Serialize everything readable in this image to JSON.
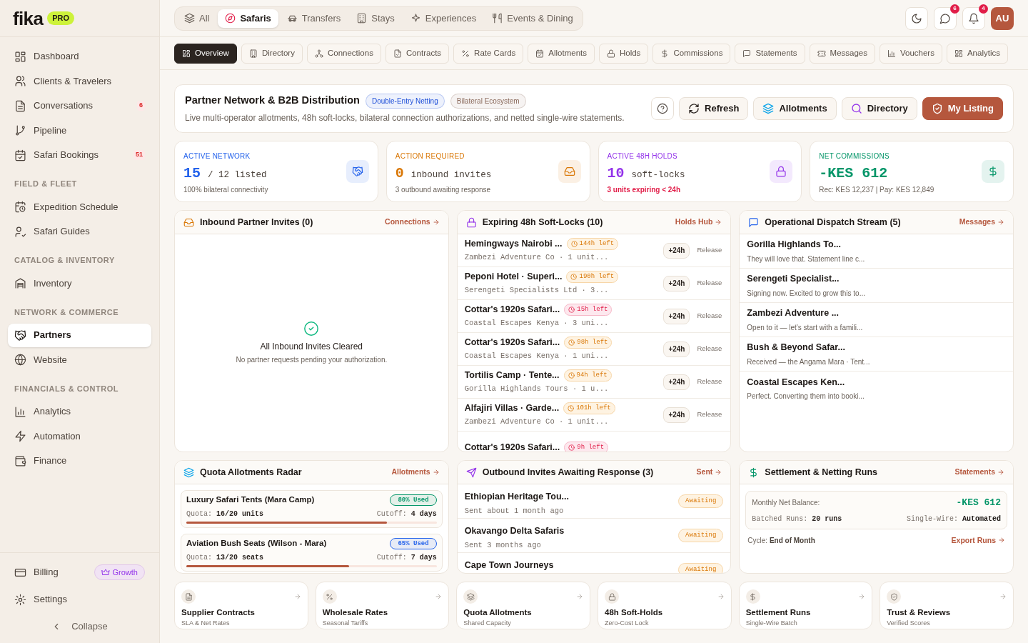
{
  "brand": {
    "logo": "fika",
    "badge": "PRO"
  },
  "sidebar": {
    "sections": [
      {
        "items": [
          {
            "label": "Dashboard",
            "selected": false
          },
          {
            "label": "Clients & Travelers",
            "selected": false
          },
          {
            "label": "Conversations",
            "badge": "6",
            "selected": false
          },
          {
            "label": "Pipeline",
            "selected": false
          },
          {
            "label": "Safari Bookings",
            "badge": "51",
            "selected": false
          }
        ]
      },
      {
        "heading": "FIELD & FLEET",
        "items": [
          {
            "label": "Expedition Schedule",
            "selected": false
          },
          {
            "label": "Safari Guides",
            "selected": false
          }
        ]
      },
      {
        "heading": "CATALOG & INVENTORY",
        "items": [
          {
            "label": "Inventory",
            "selected": false
          }
        ]
      },
      {
        "heading": "NETWORK & COMMERCE",
        "items": [
          {
            "label": "Partners",
            "selected": true
          },
          {
            "label": "Website",
            "selected": false
          }
        ]
      },
      {
        "heading": "FINANCIALS & CONTROL",
        "items": [
          {
            "label": "Analytics",
            "selected": false
          },
          {
            "label": "Automation",
            "selected": false
          },
          {
            "label": "Finance",
            "selected": false
          }
        ]
      }
    ],
    "footer": {
      "billing": "Billing",
      "plan": "Growth",
      "settings": "Settings",
      "collapse": "Collapse"
    }
  },
  "category_tabs": [
    {
      "label": "All",
      "selected": false
    },
    {
      "label": "Safaris",
      "selected": true
    },
    {
      "label": "Transfers",
      "selected": false
    },
    {
      "label": "Stays",
      "selected": false
    },
    {
      "label": "Experiences",
      "selected": false
    },
    {
      "label": "Events & Dining",
      "selected": false
    }
  ],
  "top_actions": {
    "messages_count": "6",
    "notifications_count": "4",
    "avatar": "AU"
  },
  "subtabs": [
    {
      "label": "Overview",
      "selected": true
    },
    {
      "label": "Directory",
      "selected": false
    },
    {
      "label": "Connections",
      "selected": false
    },
    {
      "label": "Contracts",
      "selected": false
    },
    {
      "label": "Rate Cards",
      "selected": false
    },
    {
      "label": "Allotments",
      "selected": false
    },
    {
      "label": "Holds",
      "selected": false
    },
    {
      "label": "Commissions",
      "selected": false
    },
    {
      "label": "Statements",
      "selected": false
    },
    {
      "label": "Messages",
      "selected": false
    },
    {
      "label": "Vouchers",
      "selected": false
    },
    {
      "label": "Analytics",
      "selected": false
    }
  ],
  "page_header": {
    "title": "Partner Network & B2B Distribution",
    "tags": [
      {
        "label": "Double-Entry Netting",
        "color": "#1d4ed8"
      },
      {
        "label": "Bilateral Ecosystem",
        "color": "#8a6a5c"
      }
    ],
    "subtitle": "Live multi-operator allotments, 48h soft-locks, bilateral connection authorizations, and netted single-wire statements.",
    "buttons": [
      {
        "label": "Refresh",
        "kind": "secondary"
      },
      {
        "label": "Allotments",
        "kind": "secondary"
      },
      {
        "label": "Directory",
        "kind": "secondary"
      },
      {
        "label": "My Listing",
        "kind": "primary"
      }
    ]
  },
  "stats": [
    {
      "label": "ACTIVE NETWORK",
      "value": "15",
      "suffix": "/ 12 listed",
      "note": "100% bilateral connectivity",
      "alert": false,
      "color": "#2563eb"
    },
    {
      "label": "ACTION REQUIRED",
      "value": "0",
      "suffix": "inbound invites",
      "note": "3 outbound awaiting response",
      "alert": false,
      "color": "#d97706"
    },
    {
      "label": "ACTIVE 48H HOLDS",
      "value": "10",
      "suffix": "soft-locks",
      "note": "3 units expiring < 24h",
      "alert": true,
      "color": "#9333ea"
    },
    {
      "label": "NET COMMISSIONS",
      "value": "-KES 612",
      "note": "Rec: KES 12,237 | Pay: KES 12,849",
      "alert": false,
      "color": "#059669"
    }
  ],
  "inbound": {
    "title": "Inbound Partner Invites (0)",
    "link": "Connections",
    "empty_title": "All Inbound Invites Cleared",
    "empty_text": "No partner requests pending your authorization."
  },
  "holds": {
    "title": "Expiring 48h Soft-Locks (10)",
    "link": "Holds Hub",
    "rows": [
      {
        "title": "Hemingways Nairobi ...",
        "badge": "144h left",
        "urgent": false,
        "subtitle": "Zambezi Adventure Co · 1 unit...",
        "extend": "+24h",
        "release": "Release"
      },
      {
        "title": "Peponi Hotel · Superi...",
        "badge": "190h left",
        "urgent": false,
        "subtitle": "Serengeti Specialists Ltd · 3...",
        "extend": "+24h",
        "release": "Release"
      },
      {
        "title": "Cottar's 1920s Safari...",
        "badge": "15h left",
        "urgent": true,
        "subtitle": "Coastal Escapes Kenya · 3 uni...",
        "extend": "+24h",
        "release": "Release"
      },
      {
        "title": "Cottar's 1920s Safari...",
        "badge": "98h left",
        "urgent": false,
        "subtitle": "Coastal Escapes Kenya · 1 uni...",
        "extend": "+24h",
        "release": "Release"
      },
      {
        "title": "Tortilis Camp · Tente...",
        "badge": "94h left",
        "urgent": false,
        "subtitle": "Gorilla Highlands Tours · 1 u...",
        "extend": "+24h",
        "release": "Release"
      },
      {
        "title": "Alfajiri Villas · Garde...",
        "badge": "101h left",
        "urgent": false,
        "subtitle": "Zambezi Adventure Co · 1 unit...",
        "extend": "+24h",
        "release": "Release"
      },
      {
        "title": "Cottar's 1920s Safari...",
        "badge": "9h left",
        "urgent": true
      }
    ]
  },
  "dispatch": {
    "title": "Operational Dispatch Stream (5)",
    "link": "Messages",
    "messages": [
      {
        "name": "Gorilla Highlands To...",
        "preview": "They will love that. Statement line c..."
      },
      {
        "name": "Serengeti Specialist...",
        "preview": "Signing now. Excited to grow this to..."
      },
      {
        "name": "Zambezi Adventure ...",
        "preview": "Open to it — let's start with a famili..."
      },
      {
        "name": "Bush & Beyond Safar...",
        "preview": "Received — the Angama Mara · Tent..."
      },
      {
        "name": "Coastal Escapes Ken...",
        "preview": "Perfect. Converting them into booki..."
      }
    ]
  },
  "quota": {
    "title": "Quota Allotments Radar",
    "link": "Allotments",
    "items": [
      {
        "name": "Luxury Safari Tents (Mara Camp)",
        "used": "80% Used",
        "color": "#059669",
        "quota_label": "Quota:",
        "quota": "16/20 units",
        "cutoff_label": "Cutoff:",
        "cutoff": "4 days",
        "level": 0.8
      },
      {
        "name": "Aviation Bush Seats (Wilson - Mara)",
        "used": "65% Used",
        "color": "#2563eb",
        "quota_label": "Quota:",
        "quota": "13/20 seats",
        "cutoff_label": "Cutoff:",
        "cutoff": "7 days",
        "level": 0.65
      }
    ]
  },
  "outbound": {
    "title": "Outbound Invites Awaiting Response (3)",
    "link": "Sent",
    "rows": [
      {
        "name": "Ethiopian Heritage Tou...",
        "sent": "Sent about 1 month ago",
        "status": "Awaiting"
      },
      {
        "name": "Okavango Delta Safaris",
        "sent": "Sent 3 months ago",
        "status": "Awaiting"
      },
      {
        "name": "Cape Town Journeys",
        "status": "Awaiting"
      }
    ]
  },
  "settlement": {
    "title": "Settlement & Netting Runs",
    "link": "Statements",
    "balance_label": "Monthly Net Balance:",
    "balance": "-KES 612",
    "runs_label": "Batched Runs:",
    "runs": "20 runs",
    "wire_label": "Single-Wire:",
    "wire": "Automated",
    "cycle_label": "Cycle:",
    "cycle": "End of Month",
    "export": "Export Runs"
  },
  "shortcuts": [
    {
      "title": "Supplier Contracts",
      "subtitle": "SLA & Net Rates"
    },
    {
      "title": "Wholesale Rates",
      "subtitle": "Seasonal Tariffs"
    },
    {
      "title": "Quota Allotments",
      "subtitle": "Shared Capacity"
    },
    {
      "title": "48h Soft-Holds",
      "subtitle": "Zero-Cost Lock"
    },
    {
      "title": "Settlement Runs",
      "subtitle": "Single-Wire Batch"
    },
    {
      "title": "Trust & Reviews",
      "subtitle": "Verified Scores"
    }
  ]
}
